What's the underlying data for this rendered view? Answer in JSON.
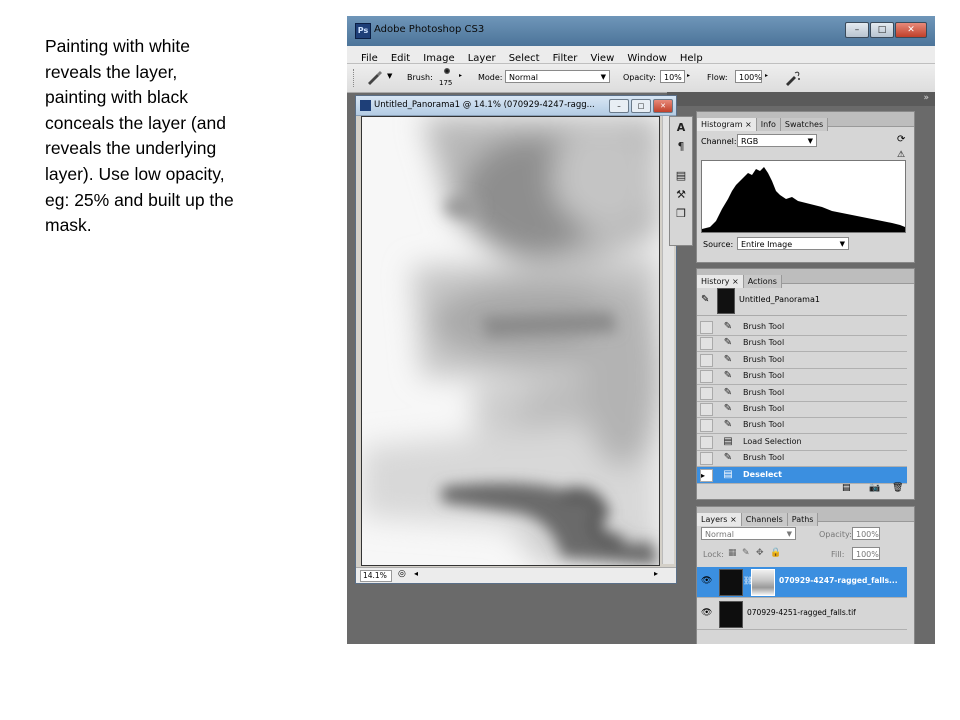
{
  "caption": {
    "lines": [
      "Painting with white",
      "reveals the layer,",
      "painting with black",
      "conceals the layer (and",
      "reveals the underlying",
      "layer).  Use low opacity,",
      "eg: 25% and built up the",
      "mask."
    ]
  },
  "app": {
    "logo": "Ps",
    "title": "Adobe Photoshop CS3",
    "window_buttons": [
      "minimize",
      "maximize",
      "close"
    ]
  },
  "menu": [
    "File",
    "Edit",
    "Image",
    "Layer",
    "Select",
    "Filter",
    "View",
    "Window",
    "Help"
  ],
  "options_bar": {
    "brush_label": "Brush:",
    "brush_size": "175",
    "mode_label": "Mode:",
    "mode_value": "Normal",
    "opacity_label": "Opacity:",
    "opacity_value": "10%",
    "flow_label": "Flow:",
    "flow_value": "100%"
  },
  "document": {
    "title": "Untitled_Panorama1 @ 14.1% (070929-4247-ragg...",
    "zoom": "14.1%"
  },
  "histogram": {
    "tabs": [
      "Histogram ×",
      "Info",
      "Swatches"
    ],
    "channel_label": "Channel:",
    "channel_value": "RGB",
    "source_label": "Source:",
    "source_value": "Entire Image"
  },
  "history": {
    "tabs": [
      "History ×",
      "Actions"
    ],
    "snapshot": "Untitled_Panorama1",
    "items": [
      {
        "label": "Brush Tool",
        "icon": "brush-icon",
        "selected": false
      },
      {
        "label": "Brush Tool",
        "icon": "brush-icon",
        "selected": false
      },
      {
        "label": "Brush Tool",
        "icon": "brush-icon",
        "selected": false
      },
      {
        "label": "Brush Tool",
        "icon": "brush-icon",
        "selected": false
      },
      {
        "label": "Brush Tool",
        "icon": "brush-icon",
        "selected": false
      },
      {
        "label": "Brush Tool",
        "icon": "brush-icon",
        "selected": false
      },
      {
        "label": "Brush Tool",
        "icon": "brush-icon",
        "selected": false
      },
      {
        "label": "Load Selection",
        "icon": "document-icon",
        "selected": false
      },
      {
        "label": "Brush Tool",
        "icon": "brush-icon",
        "selected": false
      },
      {
        "label": "Deselect",
        "icon": "document-icon",
        "selected": true
      }
    ]
  },
  "layers": {
    "tabs": [
      "Layers ×",
      "Channels",
      "Paths"
    ],
    "blend_mode": "Normal",
    "opacity_label": "Opacity:",
    "opacity_value": "100%",
    "lock_label": "Lock:",
    "fill_label": "Fill:",
    "fill_value": "100%",
    "items": [
      {
        "name": "070929-4247-ragged_falls...",
        "selected": true,
        "has_mask": true
      },
      {
        "name": "070929-4251-ragged_falls.tif",
        "selected": false,
        "has_mask": false
      }
    ]
  },
  "colors": {
    "title_bar": "#5a82a8",
    "selection": "#3b8fe0",
    "panel_bg": "#d6d6d6",
    "workspace": "#6a6a6a"
  }
}
